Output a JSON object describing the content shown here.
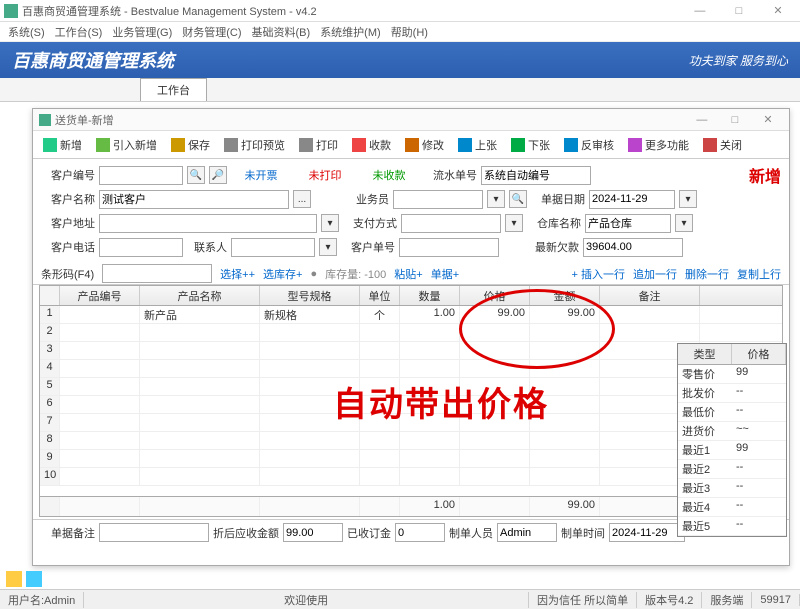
{
  "app": {
    "title": "百惠商贸通管理系统 - Bestvalue Management System - v4.2"
  },
  "menu": [
    "系统(S)",
    "工作台(S)",
    "业务管理(G)",
    "财务管理(C)",
    "基础资料(B)",
    "系统维护(M)",
    "帮助(H)"
  ],
  "banner": {
    "brand": "百惠商贸通管理系统",
    "slogan": "功夫到家 服务到心"
  },
  "tabs": {
    "main": "工作台"
  },
  "child": {
    "title": "送货单-新增",
    "toolbar": {
      "add": "新增",
      "import": "引入新增",
      "save": "保存",
      "preview": "打印预览",
      "print": "打印",
      "collect": "收款",
      "edit": "修改",
      "up": "上张",
      "down": "下张",
      "recheck": "反审核",
      "more": "更多功能",
      "close": "关闭"
    },
    "form": {
      "custCodeLbl": "客户编号",
      "custCode": "",
      "custNameLbl": "客户名称",
      "custName": "测试客户",
      "custAddrLbl": "客户地址",
      "custAddr": "",
      "custTelLbl": "客户电话",
      "contactLbl": "联系人",
      "contact": "",
      "status1": "未开票",
      "status2": "未打印",
      "status3": "未收款",
      "flowNoLbl": "流水单号",
      "flowNo": "系统自动编号",
      "billDateLbl": "单据日期",
      "billDate": "2024-11-29",
      "salesLbl": "业务员",
      "sales": "",
      "payLbl": "支付方式",
      "pay": "",
      "custNoLbl": "客户单号",
      "custNo": "",
      "whLbl": "仓库名称",
      "wh": "产品仓库",
      "lastDebtLbl": "最新欠款",
      "lastDebt": "39604.00",
      "stateBig": "新增"
    },
    "tbar2": {
      "barcode": "条形码(F4)",
      "selPlus": "选择++",
      "selStock": "选库存+",
      "stockQty": "库存量: -100",
      "paste": "粘贴+",
      "oddRow": "单据+",
      "insert": "+ 插入一行",
      "append": "追加一行",
      "delete": "删除一行",
      "copy": "复制上行"
    },
    "grid": {
      "headers": [
        "产品编号",
        "产品名称",
        "型号规格",
        "单位",
        "数量",
        "价格",
        "金额",
        "备注"
      ],
      "rows": [
        {
          "idx": "1",
          "code": "",
          "name": "新产品",
          "spec": "新规格",
          "unit": "个",
          "qty": "1.00",
          "price": "99.00",
          "amt": "99.00",
          "note": ""
        }
      ],
      "emptyIdx": [
        "2",
        "3",
        "4",
        "5",
        "6",
        "7",
        "8",
        "9",
        "10"
      ],
      "footer": {
        "qty": "1.00",
        "amt": "99.00"
      }
    },
    "annotation": "自动带出价格",
    "pricePop": {
      "head": [
        "类型",
        "价格"
      ],
      "rows": [
        [
          "零售价",
          "99"
        ],
        [
          "批发价",
          "--"
        ],
        [
          "最低价",
          "--"
        ],
        [
          "进货价",
          "~~"
        ],
        [
          "最近1",
          "99"
        ],
        [
          "最近2",
          "--"
        ],
        [
          "最近3",
          "--"
        ],
        [
          "最近4",
          "--"
        ],
        [
          "最近5",
          "--"
        ]
      ]
    },
    "bottom": {
      "noteLbl": "单据备注",
      "note": "",
      "discLbl": "折后应收金额",
      "disc": "99.00",
      "depLbl": "已收订金",
      "dep": "0",
      "makerLbl": "制单人员",
      "maker": "Admin",
      "makeTimeLbl": "制单时间",
      "makeTime": "2024-11-29"
    }
  },
  "status": {
    "user": "用户名:Admin",
    "welcome": "欢迎使用",
    "trust": "因为信任 所以简单",
    "ver": "版本号4.2",
    "svc": "服务端",
    "port": "59917"
  }
}
